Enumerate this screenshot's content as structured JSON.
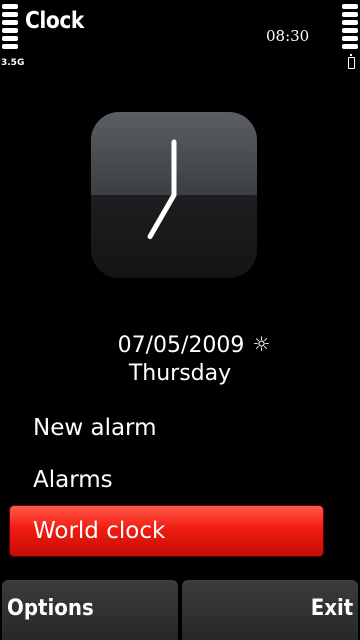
{
  "app": {
    "title": "Clock"
  },
  "status": {
    "time": "08:30",
    "network": "3.5G"
  },
  "clock": {
    "hour": 7,
    "minute": 0
  },
  "date": {
    "value": "07/05/2009",
    "weekday": "Thursday",
    "icon": "sun-icon"
  },
  "menu": {
    "items": [
      {
        "label": "New alarm",
        "selected": false
      },
      {
        "label": "Alarms",
        "selected": false
      },
      {
        "label": "World clock",
        "selected": true
      }
    ]
  },
  "softkeys": {
    "left": "Options",
    "right": "Exit"
  },
  "colors": {
    "accent": "#f21c10",
    "background": "#000000"
  }
}
